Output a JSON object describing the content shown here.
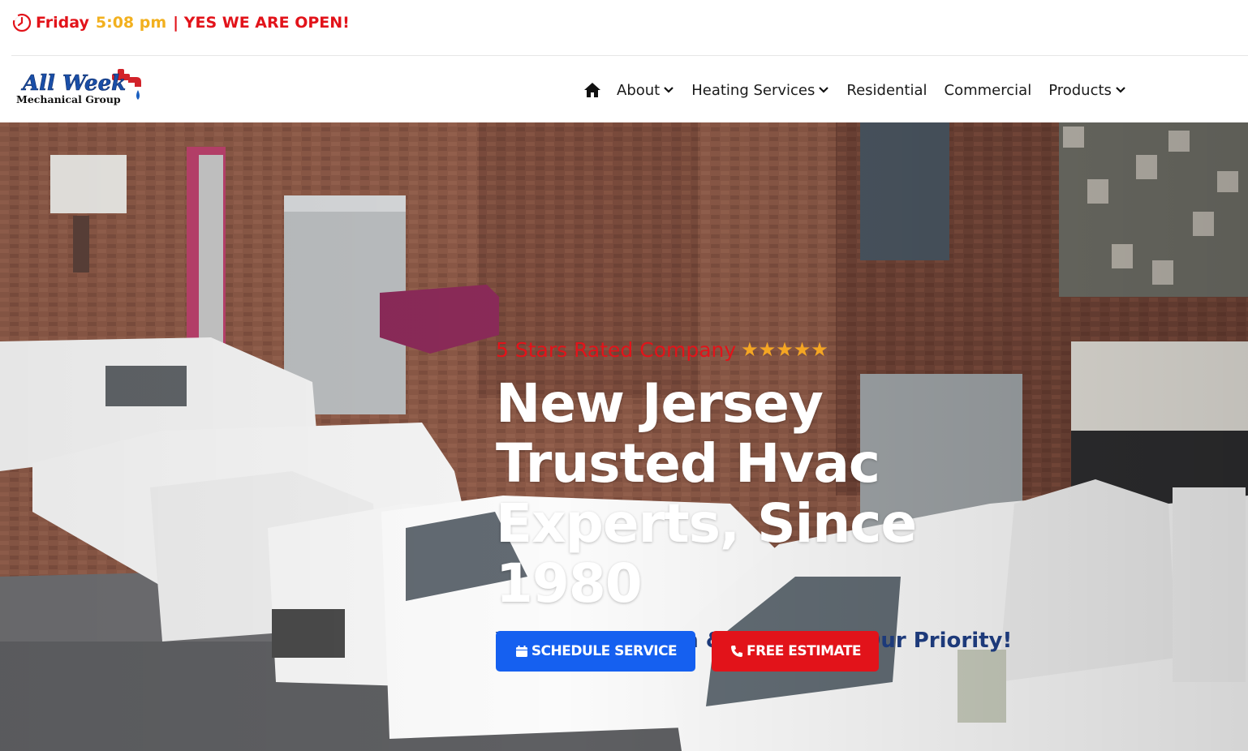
{
  "topbar": {
    "day": "Friday",
    "time": "5:08 pm",
    "message": "| YES WE ARE OPEN!",
    "icon": "clock-icon"
  },
  "header": {
    "logo": {
      "line1": "All Week",
      "line2": "Mechanical Group"
    },
    "nav": {
      "home_icon": "home-icon",
      "items": [
        {
          "label": "About",
          "has_dropdown": true
        },
        {
          "label": "Heating Services",
          "has_dropdown": true
        },
        {
          "label": "Residential",
          "has_dropdown": false
        },
        {
          "label": "Commercial",
          "has_dropdown": false
        },
        {
          "label": "Products",
          "has_dropdown": true
        }
      ]
    }
  },
  "hero": {
    "rating_text": "5 Stars Rated Company",
    "stars": "★★★★★",
    "headline": [
      "New Jersey",
      "Trusted Hvac",
      "Experts, Since 1980"
    ],
    "tagline": "Your Satisfaction & Comfort Is Our Priority!",
    "buttons": {
      "schedule": {
        "label": "SCHEDULE SERVICE",
        "icon": "calendar-icon"
      },
      "estimate": {
        "label": "FREE ESTIMATE",
        "icon": "phone-icon"
      }
    }
  },
  "colors": {
    "accent_red": "#e2131a",
    "accent_yellow": "#f2b01e",
    "brand_blue": "#1560f0",
    "tagline_navy": "#1d3a7a"
  }
}
